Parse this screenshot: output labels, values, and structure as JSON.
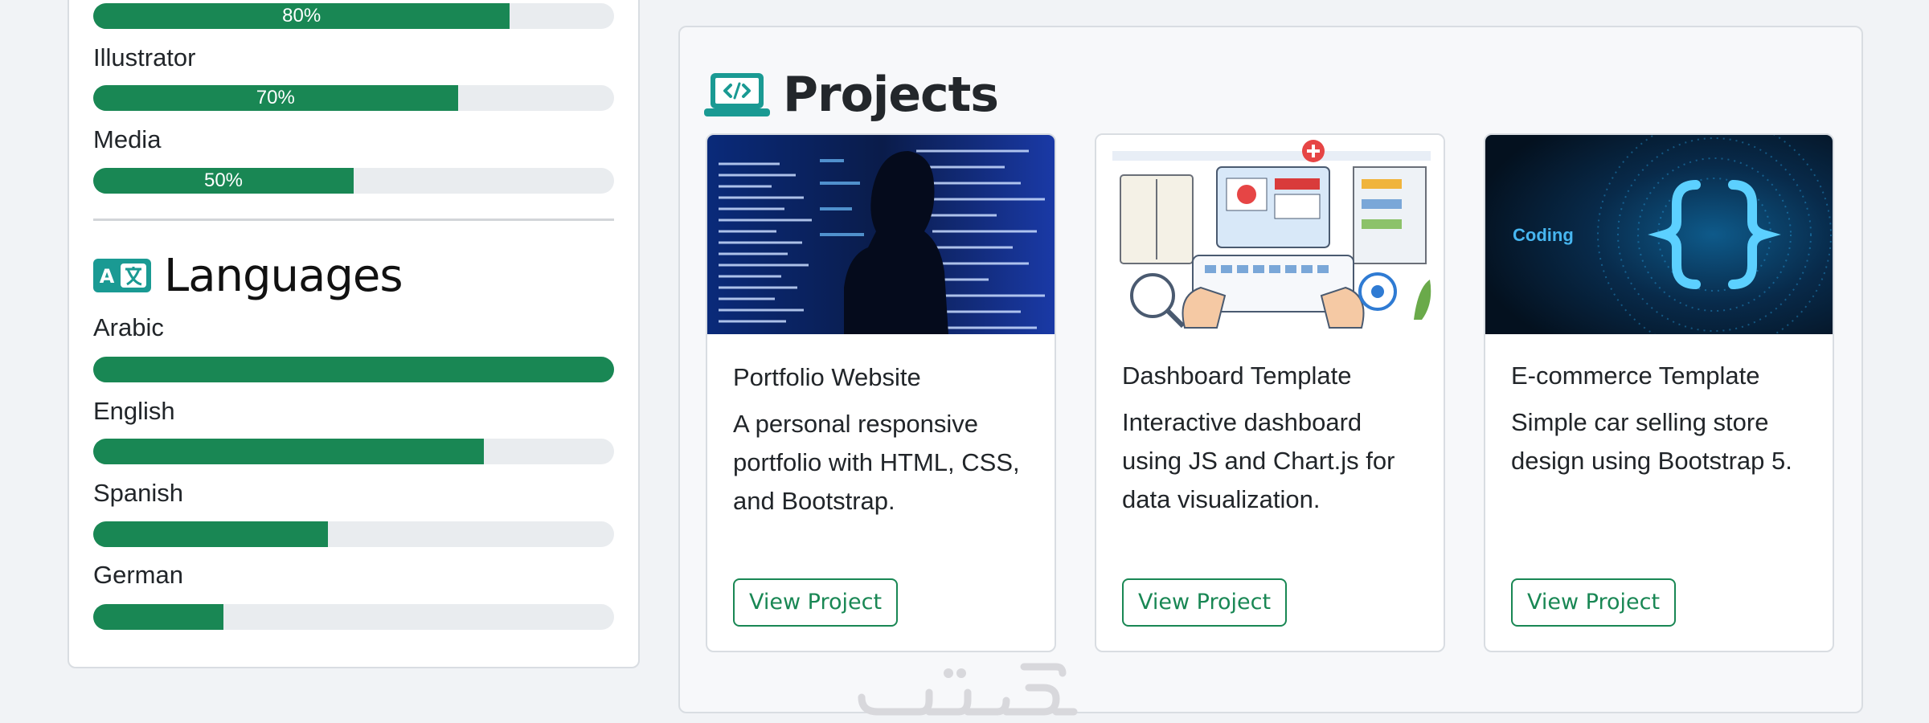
{
  "skills": [
    {
      "label": "",
      "value": 80,
      "text": "80%"
    },
    {
      "label": "Illustrator",
      "value": 70,
      "text": "70%"
    },
    {
      "label": "Media",
      "value": 50,
      "text": "50%"
    }
  ],
  "languages": {
    "title": "Languages",
    "icon": "translate-icon",
    "items": [
      {
        "label": "Arabic",
        "value": 100
      },
      {
        "label": "English",
        "value": 75
      },
      {
        "label": "Spanish",
        "value": 45
      },
      {
        "label": "German",
        "value": 25
      }
    ]
  },
  "projects": {
    "title": "Projects",
    "icon": "laptop-code-icon",
    "cards": [
      {
        "title": "Portfolio Website",
        "text": "A personal responsive portfolio with HTML, CSS, and Bootstrap.",
        "button": "View Project",
        "image": "person-silhouette-code-screen-image"
      },
      {
        "title": "Dashboard Template",
        "text": "Interactive dashboard using JS and Chart.js for data visualization.",
        "button": "View Project",
        "image": "dashboard-illustration-image"
      },
      {
        "title": "E-commerce Template",
        "text": "Simple car selling store design using Bootstrap 5.",
        "button": "View Project",
        "image": "coding-braces-image",
        "image_caption": "Coding"
      }
    ]
  },
  "colors": {
    "accent": "#198754",
    "track": "#e9ecef",
    "icon": "#1a9a93",
    "background": "#f1f3f6"
  },
  "watermark": "خمسات"
}
